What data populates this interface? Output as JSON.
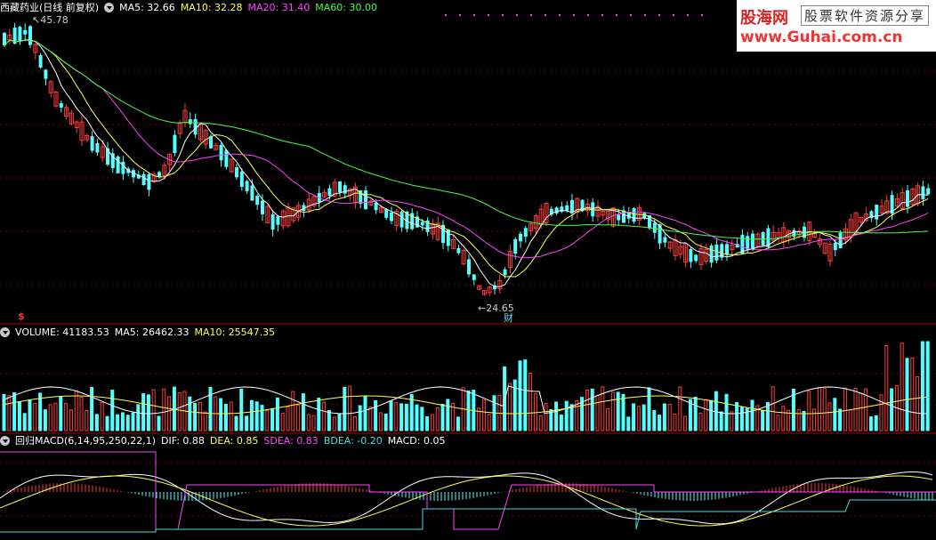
{
  "main_panel": {
    "stock_name": "西藏药业(日线 前复权)",
    "ma5": "MA5: 32.66",
    "ma10": "MA10: 32.28",
    "ma20": "MA20: 31.40",
    "ma60": "MA60: 30.00",
    "high_label": "45.78",
    "low_label": "24.65",
    "fin_marker": "财",
    "s_marker": "$"
  },
  "volume_panel": {
    "title": "VOLUME: 41183.53",
    "ma5": "MA5: 26462.33",
    "ma10": "MA10: 25547.35"
  },
  "macd_panel": {
    "title": "回归MACD(6,14,95,250,22,1)",
    "dif": "DIF: 0.88",
    "dea": "DEA: 0.85",
    "sdea": "SDEA: 0.83",
    "bdea": "BDEA: -0.20",
    "macd": "MACD: 0.05"
  },
  "watermark": {
    "logo": "股海网",
    "tagline": "股票软件资源分享",
    "url": "www.Guhai.com.cn"
  },
  "colors": {
    "up": "#ff3c3c",
    "down": "#54ffff",
    "ma5": "#ffffff",
    "ma10": "#ffff55",
    "ma20": "#ff44ff",
    "ma60": "#44ff44",
    "sdea": "#ff44ff",
    "bdea": "#44dddd",
    "grid": "#7a0000",
    "border": "#aa0000"
  }
}
